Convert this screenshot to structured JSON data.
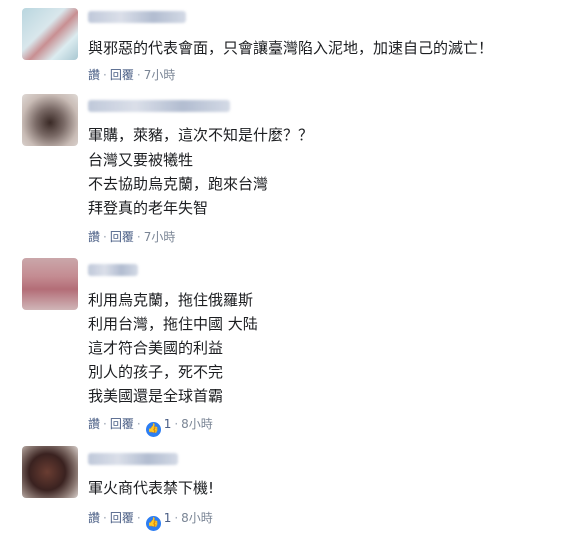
{
  "comments": [
    {
      "lines": [
        "與邪惡的代表會面，只會讓臺灣陷入泥地，加速自己的滅亡！"
      ],
      "meta": {
        "reply": "讚",
        "sep": "·",
        "reply2": "回覆",
        "time": "7小時"
      }
    },
    {
      "lines": [
        "軍購，萊豬，這次不知是什麼？？",
        "台灣又要被犧牲",
        "不去協助烏克蘭，跑來台灣",
        "拜登真的老年失智"
      ],
      "meta": {
        "reply": "讚",
        "sep": "·",
        "reply2": "回覆",
        "time": "7小時"
      }
    },
    {
      "lines": [
        "利用烏克蘭，拖住俄羅斯",
        "利用台灣，拖住中國 大陆",
        "這才符合美國的利益",
        "別人的孩子，死不完",
        "我美國還是全球首霸"
      ],
      "meta": {
        "reply": "讚",
        "sep": "·",
        "reply2": "回覆",
        "likes": "1",
        "time": "8小時"
      }
    },
    {
      "lines": [
        "軍火商代表禁下機!"
      ],
      "meta": {
        "reply": "讚",
        "sep": "·",
        "reply2": "回覆",
        "likes": "1",
        "time": "8小時"
      }
    }
  ],
  "icons": {
    "like": "thumbs-up-icon"
  },
  "colors": {
    "like_badge": "#2d7ef2",
    "action_text": "#4b5f86"
  }
}
